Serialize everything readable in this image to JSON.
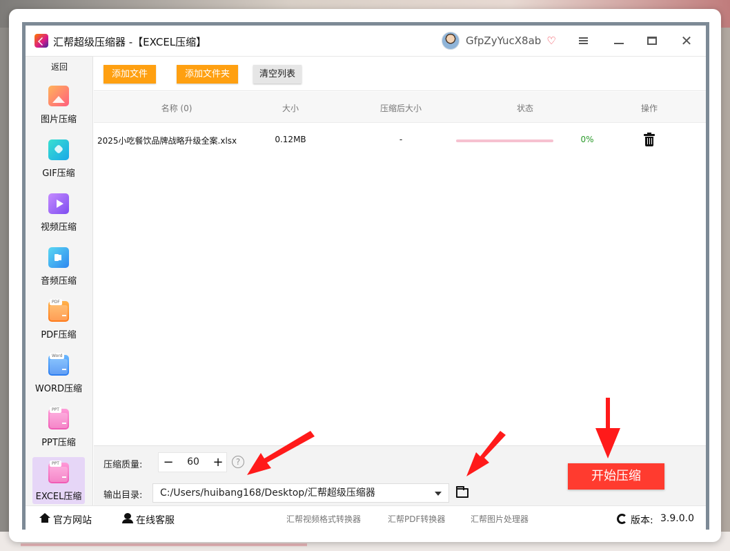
{
  "window": {
    "title": "汇帮超级压缩器  -【EXCEL压缩】",
    "username": "GfpZyYucX8ab"
  },
  "sidebar": {
    "back_label": "返回",
    "items": [
      {
        "label": "图片压缩",
        "icon": "image-icon"
      },
      {
        "label": "GIF压缩",
        "icon": "gif-icon"
      },
      {
        "label": "视频压缩",
        "icon": "video-icon"
      },
      {
        "label": "音频压缩",
        "icon": "audio-icon"
      },
      {
        "label": "PDF压缩",
        "icon": "pdf-icon",
        "tag": "PDF"
      },
      {
        "label": "WORD压缩",
        "icon": "word-icon",
        "tag": "Word"
      },
      {
        "label": "PPT压缩",
        "icon": "ppt-icon",
        "tag": "PPT"
      },
      {
        "label": "EXCEL压缩",
        "icon": "excel-icon",
        "tag": "PPT",
        "active": true
      }
    ]
  },
  "toolbar": {
    "add_file": "添加文件",
    "add_folder": "添加文件夹",
    "clear_list": "清空列表"
  },
  "table": {
    "columns": [
      "名称 (0)",
      "大小",
      "压缩后大小",
      "状态",
      "操作"
    ],
    "rows": [
      {
        "name": "2025小吃餐饮品牌战略升级全案.xlsx",
        "size": "0.12MB",
        "compressed_size": "-",
        "status_percent": "0%",
        "progress": 0
      }
    ]
  },
  "settings": {
    "quality_label": "压缩质量:",
    "quality_value": "60",
    "quality_minus": "−",
    "quality_plus": "+",
    "help": "?",
    "output_label": "输出目录:",
    "output_path": "C:/Users/huibang168/Desktop/汇帮超级压缩器",
    "start_button": "开始压缩"
  },
  "footer": {
    "website": "官方网站",
    "service": "在线客服",
    "tools": [
      "汇帮视频格式转换器",
      "汇帮PDF转换器",
      "汇帮图片处理器"
    ],
    "version_label": "版本:",
    "version": "3.9.0.0"
  },
  "colors": {
    "accent_orange": "#ffa011",
    "start_red": "#ff3b2f",
    "active_sidebar": "#e6d6f7",
    "progress_pink": "#f6c1d0",
    "percent_green": "#2a9a2a",
    "annotation_arrow": "#ff1a1a"
  }
}
